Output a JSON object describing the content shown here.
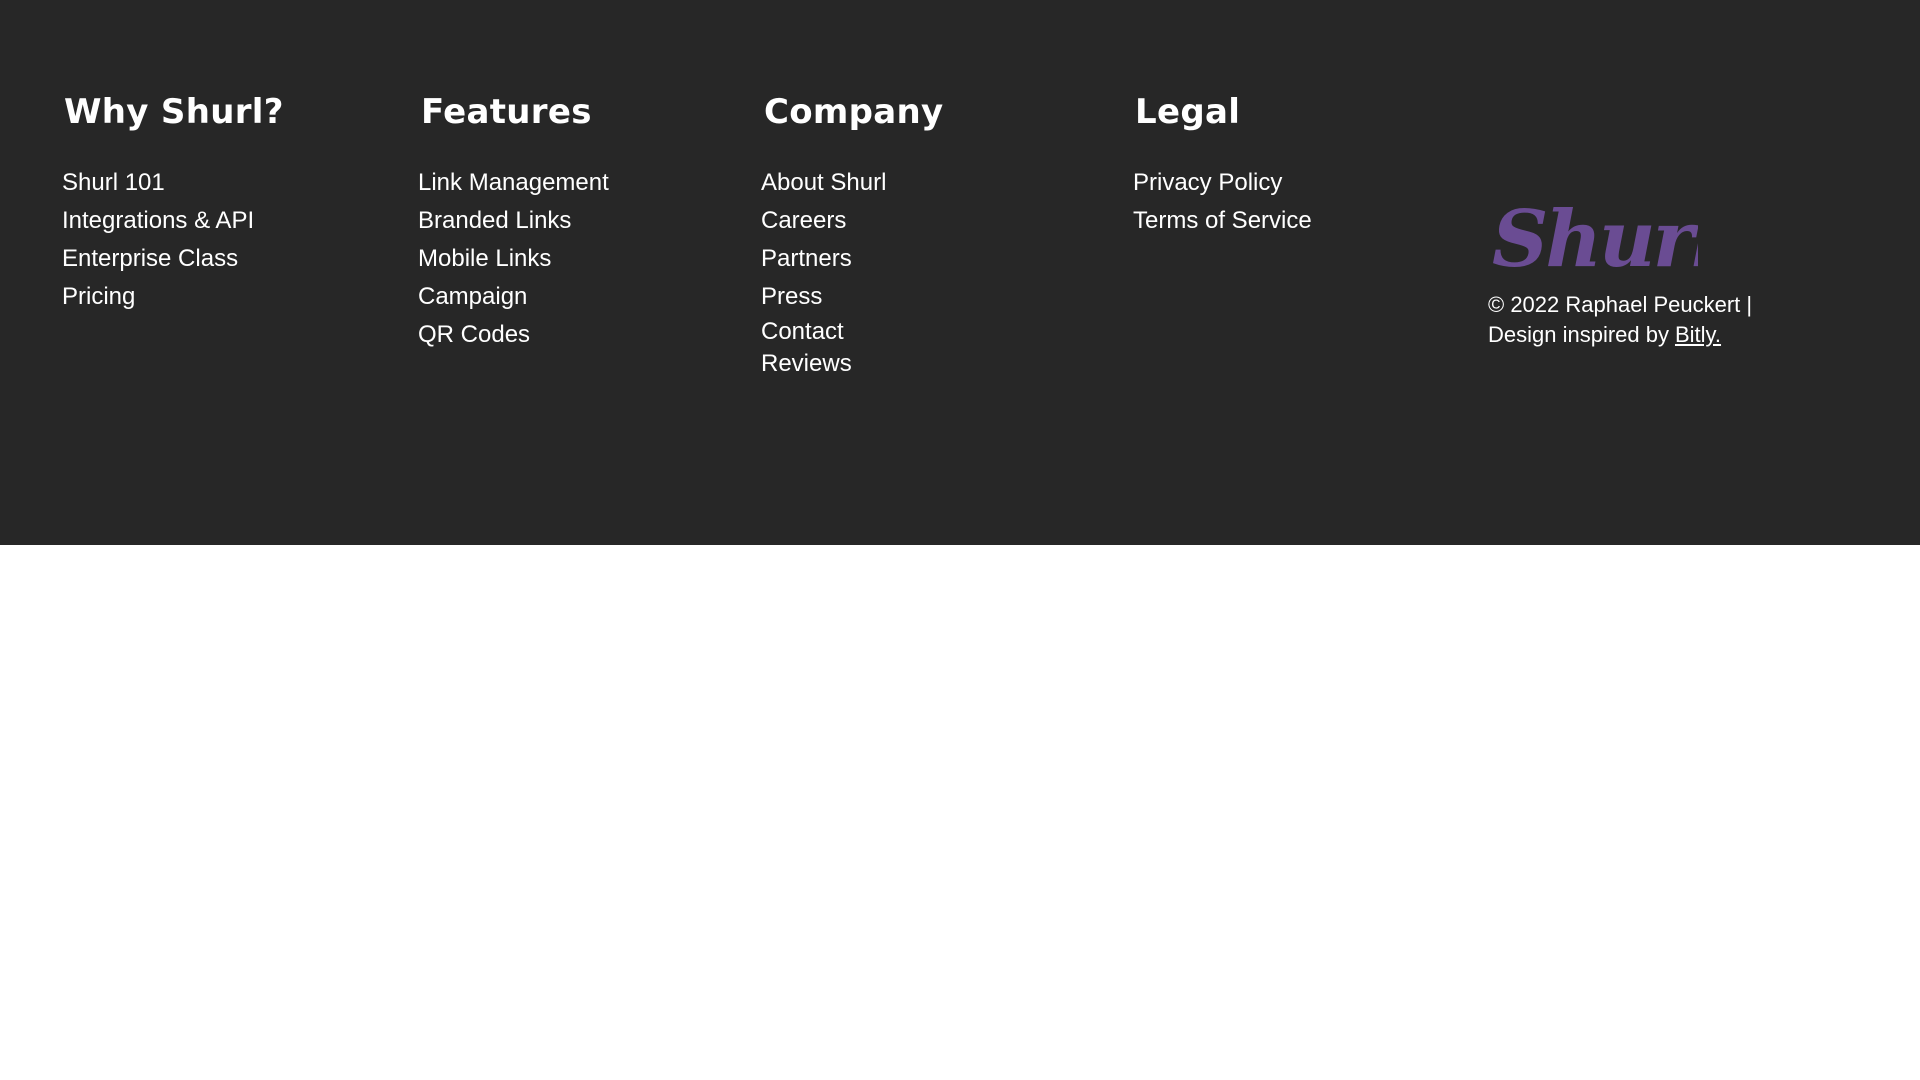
{
  "footer": {
    "columns": [
      {
        "heading": "Why Shurl?",
        "links": [
          "Shurl 101",
          "Integrations & API",
          "Enterprise Class",
          "Pricing"
        ]
      },
      {
        "heading": "Features",
        "links": [
          "Link Management",
          "Branded Links",
          "Mobile Links",
          "Campaign",
          "QR Codes"
        ]
      },
      {
        "heading": "Company",
        "links": [
          "About Shurl",
          "Careers",
          "Partners",
          "Press",
          "Contact",
          "Reviews"
        ]
      },
      {
        "heading": "Legal",
        "links": [
          "Privacy Policy",
          "Terms of Service"
        ]
      }
    ],
    "brand": {
      "logo_text": "Shurl",
      "logo_color": "#6a4c93",
      "copyright_line": "© 2022 Raphael Peuckert |",
      "inspired_prefix": "Design inspired by",
      "inspired_link": "Bitly."
    },
    "background_color": "#272727"
  }
}
